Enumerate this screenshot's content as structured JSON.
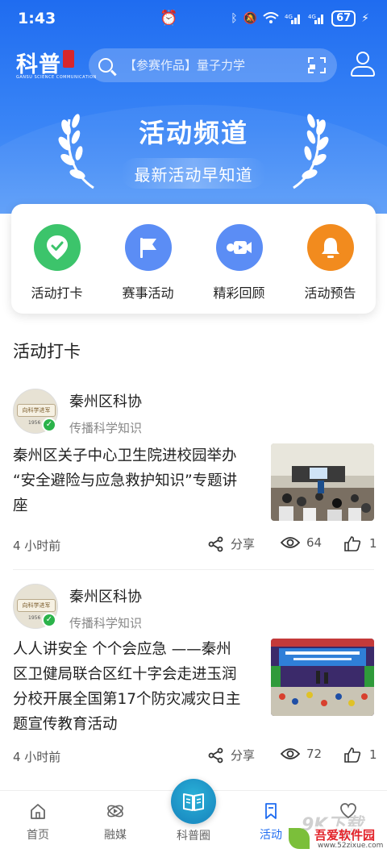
{
  "status_bar": {
    "time": "1:43",
    "battery": "67",
    "icons": [
      "alarm-icon",
      "bluetooth-icon",
      "mute-icon",
      "wifi-icon",
      "signal-4g-icon",
      "signal-4g-icon",
      "battery-icon",
      "charging-icon"
    ]
  },
  "header": {
    "logo_text": "科普",
    "logo_subtitle": "GANSU SCIENCE COMMUNICATION",
    "search_placeholder": "【参赛作品】量子力学",
    "title": "活动频道",
    "subtitle": "最新活动早知道"
  },
  "categories": [
    {
      "label": "活动打卡",
      "icon": "location-check-icon",
      "color": "#3cc46b"
    },
    {
      "label": "赛事活动",
      "icon": "flag-icon",
      "color": "#5b8df5"
    },
    {
      "label": "精彩回顾",
      "icon": "video-camera-icon",
      "color": "#5b8df5"
    },
    {
      "label": "活动预告",
      "icon": "bell-icon",
      "color": "#f28b1e"
    }
  ],
  "section_title": "活动打卡",
  "posts": [
    {
      "author": "秦州区科协",
      "author_desc": "传播科学知识",
      "avatar_text": "向科学进军",
      "avatar_year": "1956",
      "title": "秦州区关子中心卫生院进校园举办“安全避险与应急救护知识”专题讲座",
      "title_lines": [
        "秦州区关子中心卫生院进校园举办",
        "“安全避险与应急救护知识”专题讲",
        "座"
      ],
      "time": "4 小时前",
      "share_label": "分享",
      "views": "64",
      "likes": "1"
    },
    {
      "author": "秦州区科协",
      "author_desc": "传播科学知识",
      "avatar_text": "向科学进军",
      "avatar_year": "1956",
      "title": "人人讲安全 个个会应急 ——秦州区卫健局联合区红十字会走进玉润分校开展全国第17个防灾减灾日主题宣传教育活动",
      "title_lines": [
        "人人讲安全 个个会应急 ——秦州",
        "区卫健局联合区红十字会走进玉润",
        "分校开展全国第17个防灾减灾日主",
        "题宣传教育活动"
      ],
      "time": "4 小时前",
      "share_label": "分享",
      "views": "72",
      "likes": "1"
    }
  ],
  "tabbar": [
    {
      "label": "首页",
      "icon": "home-icon",
      "active": false
    },
    {
      "label": "融媒",
      "icon": "media-icon",
      "active": false
    },
    {
      "label": "科普圈",
      "icon": "book-icon",
      "active": false
    },
    {
      "label": "活动",
      "icon": "bookmark-icon",
      "active": true
    },
    {
      "label": "我的",
      "icon": "heart-icon",
      "active": false
    }
  ],
  "watermark": {
    "big": "9K下载",
    "name": "吾爱软件园",
    "url": "www.52zixue.com"
  },
  "colors": {
    "primary": "#1f6cf0",
    "accent_green": "#3cc46b",
    "accent_orange": "#f28b1e"
  }
}
